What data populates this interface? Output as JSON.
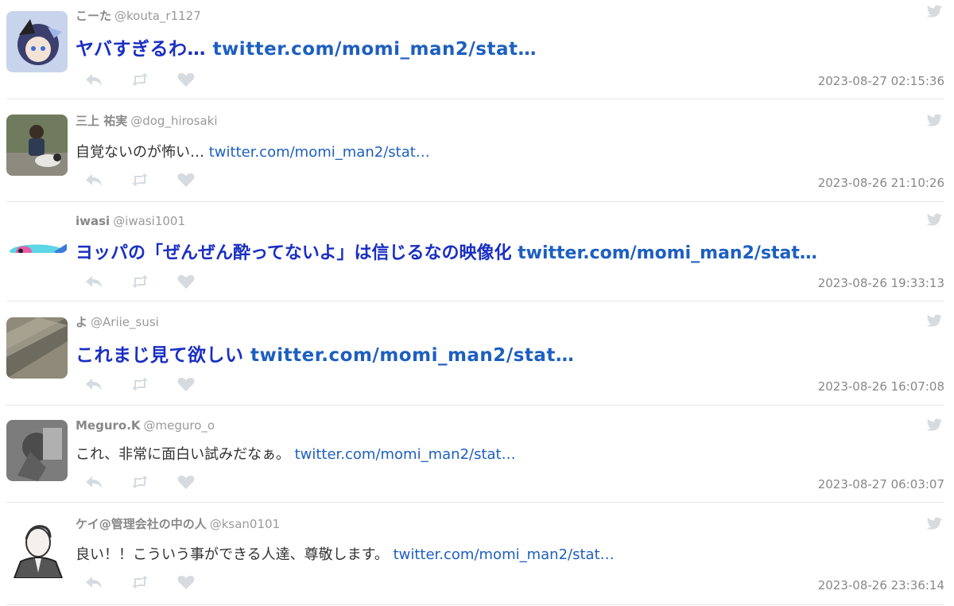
{
  "tweets": [
    {
      "name": "こーた",
      "handle": "@kouta_r1127",
      "text": "ヤバすぎるわ…",
      "link": "twitter.com/momi_man2/stat…",
      "timestamp": "2023-08-27 02:15:36",
      "size": "big",
      "avatar_colors": [
        "#3b3f6e",
        "#9fb7e8"
      ]
    },
    {
      "name": "三上 祐実",
      "handle": "@dog_hirosaki",
      "text": "自覚ないのが怖い…",
      "link": "twitter.com/momi_man2/stat…",
      "timestamp": "2023-08-26 21:10:26",
      "size": "small",
      "avatar_colors": [
        "#5a6b4a",
        "#a9a59a"
      ]
    },
    {
      "name": "iwasi",
      "handle": "@iwasi1001",
      "text": "ヨッパの「ぜんぜん酔ってないよ」は信じるなの映像化",
      "link": "twitter.com/momi_man2/stat…",
      "timestamp": "2023-08-26 19:33:13",
      "size": "big",
      "avatar_colors": [
        "#5dd6e6",
        "#e85da8"
      ]
    },
    {
      "name": "よ",
      "handle": "@Ariie_susi",
      "text": "これまじ見て欲しい",
      "link": "twitter.com/momi_man2/stat…",
      "timestamp": "2023-08-26 16:07:08",
      "size": "big",
      "avatar_colors": [
        "#6d6a5e",
        "#b8b2a0"
      ]
    },
    {
      "name": "Meguro.K",
      "handle": "@meguro_o",
      "text": "これ、非常に面白い試みだなぁ。",
      "link": "twitter.com/momi_man2/stat…",
      "timestamp": "2023-08-27 06:03:07",
      "size": "small",
      "avatar_colors": [
        "#5b5b5b",
        "#9c9c9c"
      ]
    },
    {
      "name": "ケイ@管理会社の中の人",
      "handle": "@ksan0101",
      "text": "良い！！こういう事ができる人達、尊敬します。",
      "link": "twitter.com/momi_man2/stat…",
      "timestamp": "2023-08-26 23:36:14",
      "size": "small",
      "avatar_colors": [
        "#ffffff",
        "#333333"
      ]
    }
  ],
  "colors": {
    "link": "#1d5fc0",
    "icon": "#d6dbe0",
    "meta": "#888888"
  },
  "icons": [
    "reply-icon",
    "retweet-icon",
    "like-icon",
    "twitter-bird-icon"
  ]
}
